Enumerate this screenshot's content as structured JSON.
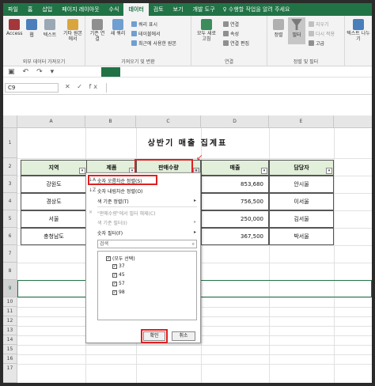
{
  "tabs": [
    "파일",
    "홈",
    "삽입",
    "페이지 레이아웃",
    "수식",
    "데이터",
    "검토",
    "보기",
    "개발 도구"
  ],
  "active_tab": "데이터",
  "tell_me": "♀ 수행할 작업을 알려 주세요",
  "ribbon": {
    "get_external": {
      "buttons": [
        "Access",
        "웹",
        "텍스트",
        "기타 원본에서"
      ],
      "group_name": "외부 데이터 가져오기"
    },
    "get_transform": {
      "existing": "기존 연결",
      "new_query": "새 쿼리",
      "show_queries": "쿼리 표시",
      "from_table": "테이블에서",
      "recent_sources": "최근에 사용한 원본",
      "group_name": "가져오기 및 변환"
    },
    "connections": {
      "refresh_all": "모두 새로 고침",
      "connections": "연결",
      "properties": "속성",
      "edit_links": "연결 편집",
      "group_name": "연결"
    },
    "sort_filter": {
      "sort": "정렬",
      "filter": "필터",
      "clear": "지우기",
      "reapply": "다시 적용",
      "advanced": "고급",
      "group_name": "정렬 및 필터"
    },
    "text_to_columns": "텍스트 나누기"
  },
  "name_box": "C9",
  "fx": "✕ ✓ fx",
  "columns": [
    "A",
    "B",
    "C",
    "D",
    "E"
  ],
  "rows": [
    "1",
    "2",
    "3",
    "4",
    "5",
    "6",
    "7",
    "8",
    "9",
    "10",
    "11",
    "12",
    "13",
    "14",
    "15",
    "16",
    "17"
  ],
  "title": "상반기 매출 집계표",
  "headers": [
    "지역",
    "제품",
    "판매수량",
    "매출",
    "담당자"
  ],
  "table": [
    {
      "region": "강원도",
      "sales": "853,680",
      "person": "안시울"
    },
    {
      "region": "경상도",
      "sales": "756,500",
      "person": "이서울"
    },
    {
      "region": "서울",
      "sales": "250,000",
      "person": "김서울"
    },
    {
      "region": "충청남도",
      "sales": "367,500",
      "person": "박서울"
    }
  ],
  "menu": {
    "sort_asc": "숫자 오름차순 정렬(S)",
    "sort_desc": "숫자 내림차순 정렬(O)",
    "sort_color": "색 기준 정렬(T)",
    "clear_filter": "\"판매수량\"에서 필터 해제(C)",
    "filter_color": "색 기준 필터(I)",
    "number_filter": "숫자 필터(F)",
    "search_placeholder": "검색",
    "items": [
      "(모두 선택)",
      "37",
      "45",
      "57",
      "98"
    ],
    "ok": "확인",
    "cancel": "취소"
  }
}
